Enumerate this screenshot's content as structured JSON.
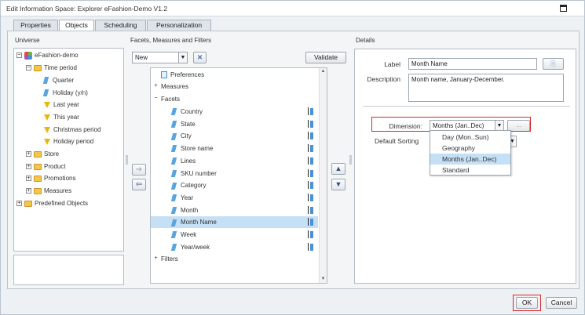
{
  "window": {
    "title": "Edit Information Space: Explorer eFashion-Demo V1.2"
  },
  "tabs": [
    {
      "label": "Properties"
    },
    {
      "label": "Objects"
    },
    {
      "label": "Scheduling"
    },
    {
      "label": "Personalization"
    }
  ],
  "universe": {
    "heading": "Universe",
    "root": "eFashion-demo",
    "time_period": "Time period",
    "quarter": "Quarter",
    "holiday": "Holiday (y/n)",
    "last_year": "Last year",
    "this_year": "This year",
    "christmas": "Christmas period",
    "holiday_period": "Holiday period",
    "store": "Store",
    "product": "Product",
    "promotions": "Promotions",
    "measures": "Measures",
    "predefined": "Predefined Objects"
  },
  "facets": {
    "heading": "Facets, Measures and Filters",
    "new_select": "New",
    "validate": "Validate",
    "preferences": "Preferences",
    "measures": "Measures",
    "facets_group": "Facets",
    "items": [
      {
        "label": "Country"
      },
      {
        "label": "State"
      },
      {
        "label": "City"
      },
      {
        "label": "Store name"
      },
      {
        "label": "Lines"
      },
      {
        "label": "SKU number"
      },
      {
        "label": "Category"
      },
      {
        "label": "Year"
      },
      {
        "label": "Month"
      },
      {
        "label": "Month Name"
      },
      {
        "label": "Week"
      },
      {
        "label": "Year/week"
      }
    ],
    "filters": "Filters"
  },
  "details": {
    "heading": "Details",
    "label_caption": "Label",
    "label_value": "Month Name",
    "description_caption": "Description",
    "description_value": "Month name, January-December.",
    "dimension_caption": "Dimension:",
    "dimension_value": "Months (Jan..Dec)",
    "ellipsis": "...",
    "default_sorting_caption": "Default Sorting",
    "options": [
      "Day (Mon..Sun)",
      "Geography",
      "Months (Jan..Dec)",
      "Standard"
    ]
  },
  "footer": {
    "ok": "OK",
    "cancel": "Cancel"
  }
}
